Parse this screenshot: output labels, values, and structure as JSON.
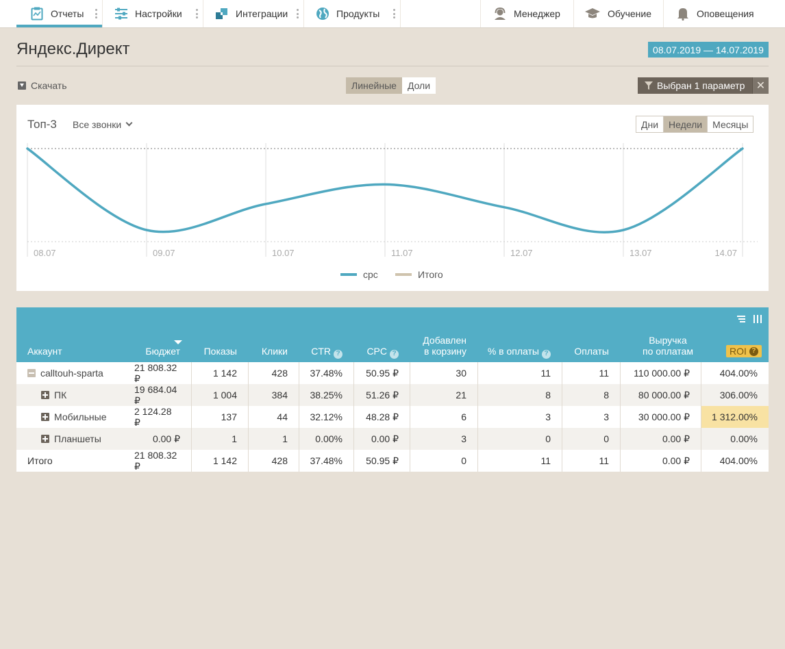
{
  "nav": {
    "reports": "Отчеты",
    "settings": "Настройки",
    "integrations": "Интеграции",
    "products": "Продукты",
    "manager": "Менеджер",
    "training": "Обучение",
    "notifications": "Оповещения"
  },
  "page": {
    "title": "Яндекс.Директ",
    "date_range": "08.07.2019 — 14.07.2019"
  },
  "toolbar": {
    "download": "Скачать",
    "view_linear": "Линейные",
    "view_shares": "Доли",
    "filter_label": "Выбран 1 параметр",
    "filter_close": "✕"
  },
  "chart_card": {
    "title": "Топ-3",
    "select_value": "Все звонки",
    "period_days": "Дни",
    "period_weeks": "Недели",
    "period_months": "Месяцы"
  },
  "chart_data": {
    "type": "line",
    "x": [
      "08.07",
      "09.07",
      "10.07",
      "11.07",
      "12.07",
      "13.07",
      "14.07"
    ],
    "series": [
      {
        "name": "cpc",
        "values": [
          1.0,
          0.0,
          0.32,
          0.56,
          0.28,
          0.0,
          1.0
        ],
        "color": "#4fa8c0"
      },
      {
        "name": "Итого",
        "values": [],
        "color": "#cfc3ad"
      }
    ],
    "ylim": [
      0,
      1
    ],
    "grid": true,
    "legend": "bottom-center"
  },
  "legend": {
    "s1": "cpc",
    "s2": "Итого"
  },
  "table": {
    "headers": {
      "account": "Аккаунт",
      "budget": "Бюджет",
      "shows": "Показы",
      "clicks": "Клики",
      "ctr": "CTR",
      "cpc": "CPC",
      "cart_1": "Добавлен",
      "cart_2": "в корзину",
      "pay_pct": "% в оплаты",
      "payments": "Оплаты",
      "revenue_1": "Выручка",
      "revenue_2": "по оплатам",
      "roi": "ROI"
    },
    "rows": [
      {
        "name": "calltouh-sparta",
        "budget": "21 808.32 ₽",
        "shows": "1 142",
        "clicks": "428",
        "ctr": "37.48%",
        "cpc": "50.95 ₽",
        "cart": "30",
        "pay_pct": "11",
        "payments": "11",
        "revenue": "110 000.00 ₽",
        "roi": "404.00%"
      },
      {
        "name": "ПК",
        "budget": "19 684.04 ₽",
        "shows": "1 004",
        "clicks": "384",
        "ctr": "38.25%",
        "cpc": "51.26 ₽",
        "cart": "21",
        "pay_pct": "8",
        "payments": "8",
        "revenue": "80 000.00 ₽",
        "roi": "306.00%"
      },
      {
        "name": "Мобильные",
        "budget": "2 124.28 ₽",
        "shows": "137",
        "clicks": "44",
        "ctr": "32.12%",
        "cpc": "48.28 ₽",
        "cart": "6",
        "pay_pct": "3",
        "payments": "3",
        "revenue": "30 000.00 ₽",
        "roi": "1 312.00%"
      },
      {
        "name": "Планшеты",
        "budget": "0.00 ₽",
        "shows": "1",
        "clicks": "1",
        "ctr": "0.00%",
        "cpc": "0.00 ₽",
        "cart": "3",
        "pay_pct": "0",
        "payments": "0",
        "revenue": "0.00 ₽",
        "roi": "0.00%"
      },
      {
        "name": "Итого",
        "budget": "21 808.32 ₽",
        "shows": "1 142",
        "clicks": "428",
        "ctr": "37.48%",
        "cpc": "50.95 ₽",
        "cart": "0",
        "pay_pct": "11",
        "payments": "11",
        "revenue": "0.00 ₽",
        "roi": "404.00%"
      }
    ]
  },
  "colors": {
    "accent": "#4fa8c0",
    "table_header": "#53aec6",
    "roi_badge": "#f0c24a",
    "roi_highlight": "#f8e2a3",
    "background": "#e7e0d6"
  }
}
